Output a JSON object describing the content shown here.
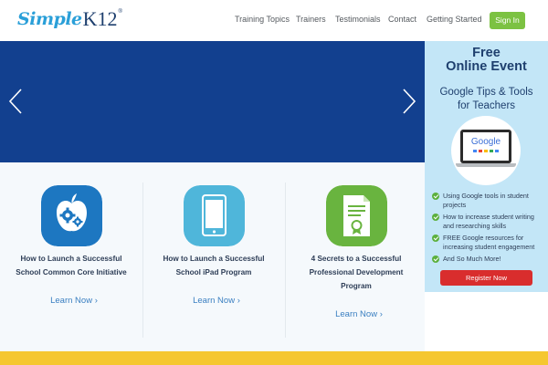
{
  "logo": {
    "part1": "Simple",
    "part2": "K12",
    "mark": "®"
  },
  "nav": {
    "items": [
      "Training Topics",
      "Trainers",
      "Testimonials",
      "Contact",
      "Getting Started"
    ],
    "signin": "Sign In"
  },
  "hero": {
    "prev_icon": "chevron-left-icon",
    "next_icon": "chevron-right-icon",
    "background_color": "#12408f"
  },
  "cards": [
    {
      "icon": "apple-gears-icon",
      "title_line1": "How to Launch a Successful",
      "title_line2": "School Common Core Initiative",
      "title_line3": "",
      "link": "Learn Now"
    },
    {
      "icon": "tablet-icon",
      "title_line1": "How to Launch a Successful",
      "title_line2": "School iPad Program",
      "title_line3": "",
      "link": "Learn Now"
    },
    {
      "icon": "certificate-icon",
      "title_line1": "4 Secrets to a Successful",
      "title_line2": "Professional Development",
      "title_line3": "Program",
      "link": "Learn Now"
    }
  ],
  "sidebar": {
    "title_line1": "Free",
    "title_line2": "Online Event",
    "subtitle_line1": "Google Tips & Tools",
    "subtitle_line2": "for Teachers",
    "laptop_screen_text": "Google",
    "bullets": [
      {
        "line1": "Using Google tools in student",
        "line2": "projects"
      },
      {
        "line1": "How to increase student writing",
        "line2": "and researching skills"
      },
      {
        "line1": "FREE Google resources for",
        "line2": "increasing student engagement"
      },
      {
        "line1": "And So Much More!",
        "line2": ""
      }
    ],
    "register": "Register Now"
  },
  "colors": {
    "accent_green": "#7cc242",
    "hero_blue": "#12408f",
    "link_blue": "#3a7fc1",
    "register_red": "#d92d2d",
    "sidebar_bg": "#c3e6f7",
    "strip_yellow": "#f5c730"
  }
}
